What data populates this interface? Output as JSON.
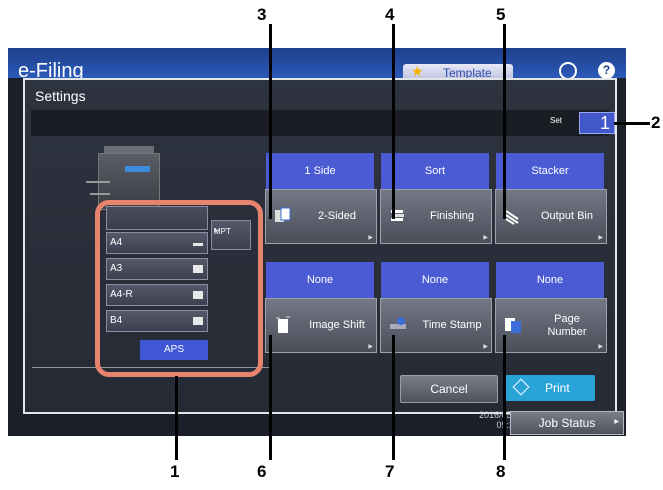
{
  "app": {
    "title": "e-Filing",
    "template_label": "Template",
    "help_label": "?"
  },
  "settings": {
    "title": "Settings",
    "set_label": "Set",
    "set_value": "1"
  },
  "paper_trays": [
    "A4",
    "A3",
    "A4-R",
    "B4"
  ],
  "mpt_label": "MPT",
  "aps_label": "APS",
  "functions": [
    {
      "status": "1 Side",
      "label": "2-Sided",
      "icon": "duplex-icon"
    },
    {
      "status": "Sort",
      "label": "Finishing",
      "icon": "finishing-icon"
    },
    {
      "status": "Stacker",
      "label": "Output Bin",
      "icon": "output-bin-icon"
    },
    {
      "status": "None",
      "label": "Image Shift",
      "icon": "image-shift-icon"
    },
    {
      "status": "None",
      "label": "Time Stamp",
      "icon": "time-stamp-icon"
    },
    {
      "status": "None",
      "label": "Page Number",
      "icon": "page-number-icon"
    }
  ],
  "buttons": {
    "cancel": "Cancel",
    "print": "Print",
    "job_status": "Job Status"
  },
  "datetime": {
    "date": "2016/05/",
    "time": "09:2"
  },
  "callouts": [
    "1",
    "2",
    "3",
    "4",
    "5",
    "6",
    "7",
    "8"
  ],
  "colors": {
    "accent_blue": "#4b5bd4",
    "print_blue": "#2aa3d8",
    "highlight_orange": "#e8836e"
  }
}
